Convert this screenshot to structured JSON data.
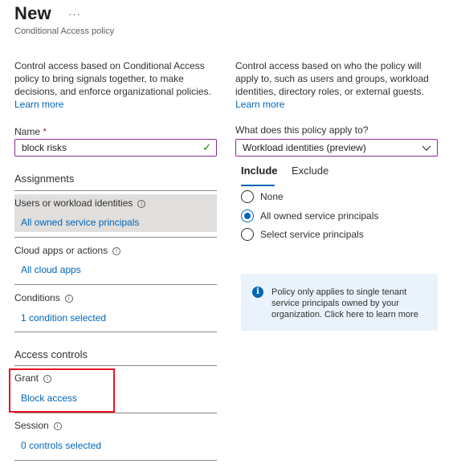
{
  "header": {
    "title": "New",
    "more_label": "···",
    "subtitle": "Conditional Access policy"
  },
  "left": {
    "description": "Control access based on Conditional Access policy to bring signals together, to make decisions, and enforce organizational policies.",
    "learn_more": "Learn more",
    "name_label": "Name",
    "name_required": "*",
    "name_value": "block risks",
    "assignments_heading": "Assignments",
    "users": {
      "label": "Users or workload identities",
      "value": "All owned service principals"
    },
    "cloud_apps": {
      "label": "Cloud apps or actions",
      "value": "All cloud apps"
    },
    "conditions": {
      "label": "Conditions",
      "value": "1 condition selected"
    },
    "access_controls_heading": "Access controls",
    "grant": {
      "label": "Grant",
      "value": "Block access"
    },
    "session": {
      "label": "Session",
      "value": "0 controls selected"
    }
  },
  "right": {
    "description": "Control access based on who the policy will apply to, such as users and groups, workload identities, directory roles, or external guests.",
    "learn_more": "Learn more",
    "applies_label": "What does this policy apply to?",
    "applies_value": "Workload identities (preview)",
    "tabs": [
      {
        "label": "Include",
        "active": true
      },
      {
        "label": "Exclude",
        "active": false
      }
    ],
    "options": [
      {
        "label": "None",
        "selected": false
      },
      {
        "label": "All owned service principals",
        "selected": true
      },
      {
        "label": "Select service principals",
        "selected": false
      }
    ],
    "info_text": "Policy only applies to single tenant service principals owned by your organization. Click here to learn more"
  },
  "icons": {
    "more": "more-icon",
    "check": "checkmark-icon",
    "info": "info-icon",
    "chevron": "chevron-down-icon"
  },
  "colors": {
    "link": "#0066b8",
    "field_border": "#8a2d8f",
    "highlight_box": "#e81123",
    "selected_row": "#e1dfdd",
    "info_bar": "#eaf3fc",
    "required": "#a4262c",
    "success": "#107c10"
  }
}
